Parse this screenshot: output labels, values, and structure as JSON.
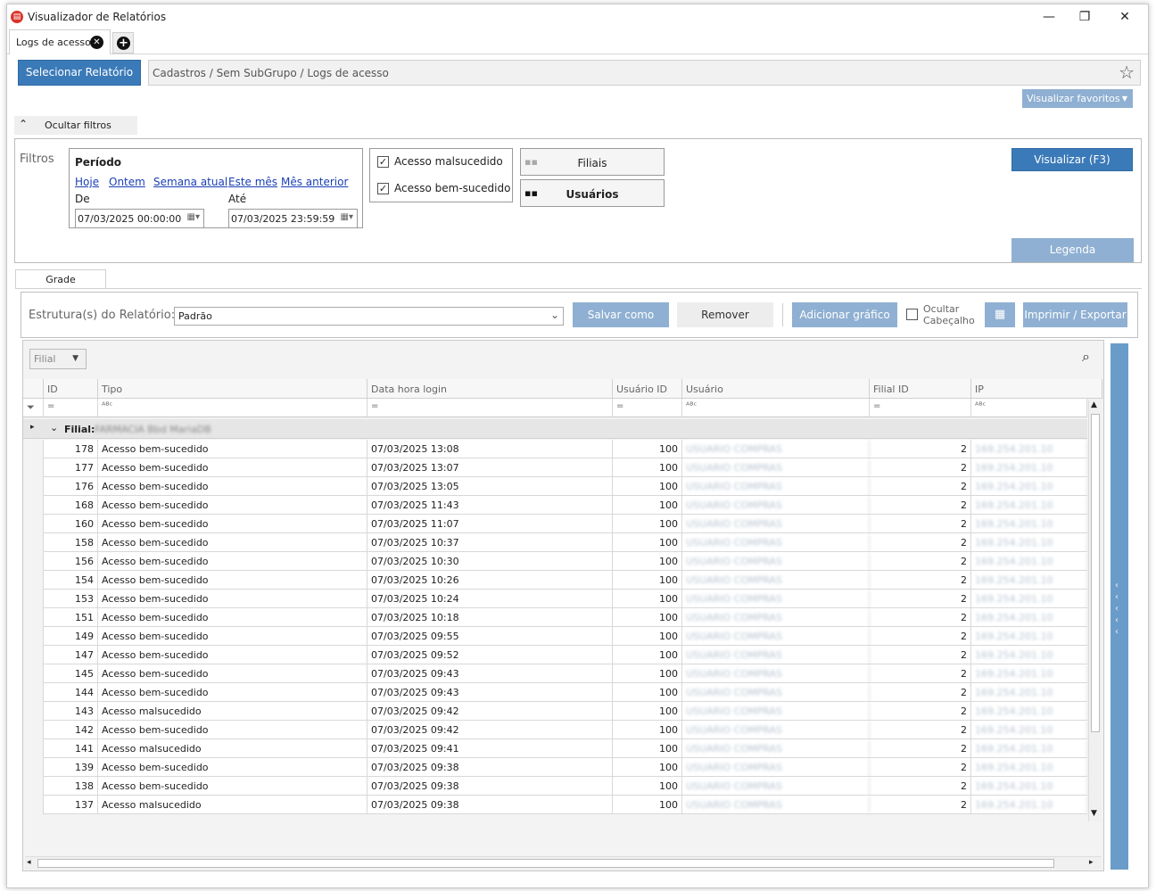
{
  "window": {
    "title": "Visualizador de Relatórios",
    "minimize": "—",
    "maximize": "❐",
    "close": "✕"
  },
  "tabs": [
    {
      "label": "Logs de acesso"
    }
  ],
  "toolbar": {
    "select_report": "Selecionar Relatório",
    "breadcrumb": "Cadastros / Sem SubGrupo / Logs de acesso",
    "favorites": "Visualizar favoritos",
    "hide_filters": "Ocultar filtros"
  },
  "filters": {
    "label": "Filtros",
    "period_title": "Período",
    "quick": [
      "Hoje",
      "Ontem",
      "Semana atual",
      "Este mês",
      "Mês anterior"
    ],
    "from_label": "De",
    "to_label": "Até",
    "from_value": "07/03/2025 00:00:00",
    "to_value": "07/03/2025 23:59:59",
    "check_fail": "Acesso malsucedido",
    "check_success": "Acesso bem-sucedido",
    "branches": "Filiais",
    "users": "Usuários",
    "view_button": "Visualizar (F3)",
    "legend_button": "Legenda"
  },
  "grid_tab": "Grade",
  "structure": {
    "label": "Estrutura(s) do Relatório:",
    "value": "Padrão",
    "save_as": "Salvar como",
    "remove": "Remover",
    "add_chart": "Adicionar gráfico",
    "hide_header_1": "Ocultar",
    "hide_header_2": "Cabeçalho",
    "print_export": "Imprimir / Exportar"
  },
  "group_chip": "Filial",
  "columns": [
    "ID",
    "Tipo",
    "Data hora login",
    "Usuário ID",
    "Usuário",
    "Filial ID",
    "IP"
  ],
  "group_label": "Filial:",
  "group_value": "FARMACIA Bbd MariaDB",
  "rows": [
    {
      "id": "178",
      "tipo": "Acesso bem-sucedido",
      "data": "07/03/2025 13:08",
      "uid": "100",
      "user": "USUARIO COMPRAS",
      "fid": "2",
      "ip": "169.254.201.10"
    },
    {
      "id": "177",
      "tipo": "Acesso bem-sucedido",
      "data": "07/03/2025 13:07",
      "uid": "100",
      "user": "USUARIO COMPRAS",
      "fid": "2",
      "ip": "169.254.201.10"
    },
    {
      "id": "176",
      "tipo": "Acesso bem-sucedido",
      "data": "07/03/2025 13:05",
      "uid": "100",
      "user": "USUARIO COMPRAS",
      "fid": "2",
      "ip": "169.254.201.10"
    },
    {
      "id": "168",
      "tipo": "Acesso bem-sucedido",
      "data": "07/03/2025 11:43",
      "uid": "100",
      "user": "USUARIO COMPRAS",
      "fid": "2",
      "ip": "169.254.201.10"
    },
    {
      "id": "160",
      "tipo": "Acesso bem-sucedido",
      "data": "07/03/2025 11:07",
      "uid": "100",
      "user": "USUARIO COMPRAS",
      "fid": "2",
      "ip": "169.254.201.10"
    },
    {
      "id": "158",
      "tipo": "Acesso bem-sucedido",
      "data": "07/03/2025 10:37",
      "uid": "100",
      "user": "USUARIO COMPRAS",
      "fid": "2",
      "ip": "169.254.201.10"
    },
    {
      "id": "156",
      "tipo": "Acesso bem-sucedido",
      "data": "07/03/2025 10:30",
      "uid": "100",
      "user": "USUARIO COMPRAS",
      "fid": "2",
      "ip": "169.254.201.10"
    },
    {
      "id": "154",
      "tipo": "Acesso bem-sucedido",
      "data": "07/03/2025 10:26",
      "uid": "100",
      "user": "USUARIO COMPRAS",
      "fid": "2",
      "ip": "169.254.201.10"
    },
    {
      "id": "153",
      "tipo": "Acesso bem-sucedido",
      "data": "07/03/2025 10:24",
      "uid": "100",
      "user": "USUARIO COMPRAS",
      "fid": "2",
      "ip": "169.254.201.10"
    },
    {
      "id": "151",
      "tipo": "Acesso bem-sucedido",
      "data": "07/03/2025 10:18",
      "uid": "100",
      "user": "USUARIO COMPRAS",
      "fid": "2",
      "ip": "169.254.201.10"
    },
    {
      "id": "149",
      "tipo": "Acesso bem-sucedido",
      "data": "07/03/2025 09:55",
      "uid": "100",
      "user": "USUARIO COMPRAS",
      "fid": "2",
      "ip": "169.254.201.10"
    },
    {
      "id": "147",
      "tipo": "Acesso bem-sucedido",
      "data": "07/03/2025 09:52",
      "uid": "100",
      "user": "USUARIO COMPRAS",
      "fid": "2",
      "ip": "169.254.201.10"
    },
    {
      "id": "145",
      "tipo": "Acesso bem-sucedido",
      "data": "07/03/2025 09:43",
      "uid": "100",
      "user": "USUARIO COMPRAS",
      "fid": "2",
      "ip": "169.254.201.10"
    },
    {
      "id": "144",
      "tipo": "Acesso bem-sucedido",
      "data": "07/03/2025 09:43",
      "uid": "100",
      "user": "USUARIO COMPRAS",
      "fid": "2",
      "ip": "169.254.201.10"
    },
    {
      "id": "143",
      "tipo": "Acesso malsucedido",
      "data": "07/03/2025 09:42",
      "uid": "100",
      "user": "USUARIO COMPRAS",
      "fid": "2",
      "ip": "169.254.201.10"
    },
    {
      "id": "142",
      "tipo": "Acesso bem-sucedido",
      "data": "07/03/2025 09:42",
      "uid": "100",
      "user": "USUARIO COMPRAS",
      "fid": "2",
      "ip": "169.254.201.10"
    },
    {
      "id": "141",
      "tipo": "Acesso malsucedido",
      "data": "07/03/2025 09:41",
      "uid": "100",
      "user": "USUARIO COMPRAS",
      "fid": "2",
      "ip": "169.254.201.10"
    },
    {
      "id": "139",
      "tipo": "Acesso bem-sucedido",
      "data": "07/03/2025 09:38",
      "uid": "100",
      "user": "USUARIO COMPRAS",
      "fid": "2",
      "ip": "169.254.201.10"
    },
    {
      "id": "138",
      "tipo": "Acesso bem-sucedido",
      "data": "07/03/2025 09:38",
      "uid": "100",
      "user": "USUARIO COMPRAS",
      "fid": "2",
      "ip": "169.254.201.10"
    },
    {
      "id": "137",
      "tipo": "Acesso malsucedido",
      "data": "07/03/2025 09:38",
      "uid": "100",
      "user": "USUARIO COMPRAS",
      "fid": "2",
      "ip": "169.254.201.10"
    }
  ],
  "colors": {
    "accent": "#3b7ab8",
    "accent_light": "#8fb0d2",
    "rail": "#6a9cc9"
  },
  "icons": {
    "app": "report-viewer-icon",
    "favorite": "star-icon",
    "search": "search-icon",
    "filter": "filter-icon",
    "excel": "excel-icon"
  }
}
